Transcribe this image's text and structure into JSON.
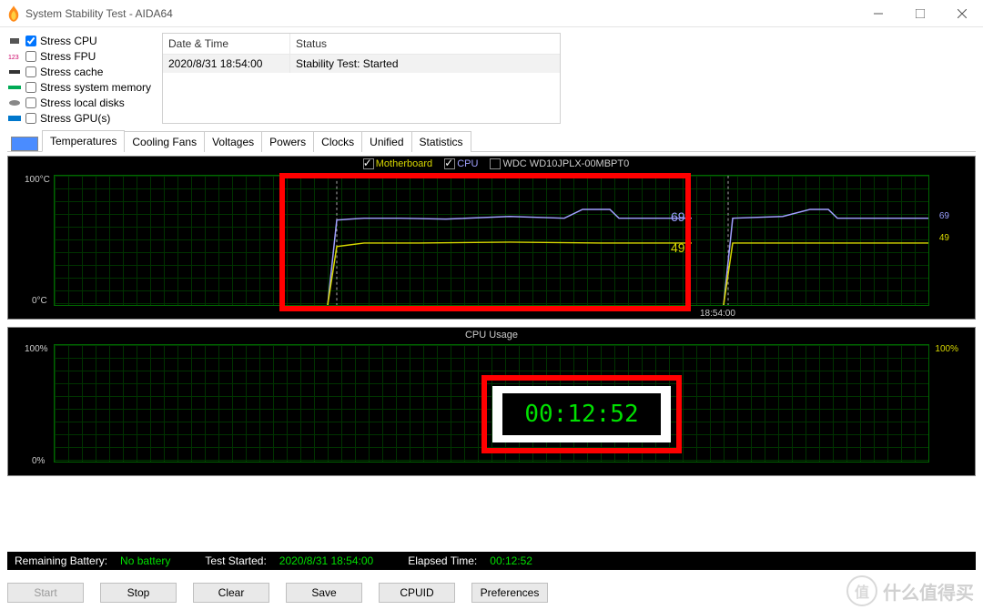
{
  "window": {
    "title": "System Stability Test - AIDA64"
  },
  "stress": {
    "cpu": {
      "label": "Stress CPU",
      "checked": true
    },
    "fpu": {
      "label": "Stress FPU",
      "checked": false
    },
    "cache": {
      "label": "Stress cache",
      "checked": false
    },
    "mem": {
      "label": "Stress system memory",
      "checked": false
    },
    "disk": {
      "label": "Stress local disks",
      "checked": false
    },
    "gpu": {
      "label": "Stress GPU(s)",
      "checked": false
    }
  },
  "log": {
    "headers": {
      "datetime": "Date & Time",
      "status": "Status"
    },
    "row0": {
      "datetime": "2020/8/31 18:54:00",
      "status": "Stability Test: Started"
    }
  },
  "tabs": [
    "Temperatures",
    "Cooling Fans",
    "Voltages",
    "Powers",
    "Clocks",
    "Unified",
    "Statistics"
  ],
  "temp_chart": {
    "title_legend": {
      "mb": "Motherboard",
      "cpu": "CPU",
      "wd": "WDC WD10JPLX-00MBPT0"
    },
    "y_max_label": "100°C",
    "y_min_label": "0°C",
    "x_tick": "18:54:00",
    "value_cpu": "69",
    "value_mb": "49",
    "right_value_cpu": "69",
    "right_value_mb": "49"
  },
  "cpu_chart": {
    "title": "CPU Usage",
    "y_max_left": "100%",
    "y_max_right": "100%",
    "y_min_left": "0%"
  },
  "overlay_timer": "00:12:52",
  "status": {
    "battery_label": "Remaining Battery:",
    "battery_value": "No battery",
    "started_label": "Test Started:",
    "started_value": "2020/8/31 18:54:00",
    "elapsed_label": "Elapsed Time:",
    "elapsed_value": "00:12:52"
  },
  "buttons": {
    "start": "Start",
    "stop": "Stop",
    "clear": "Clear",
    "save": "Save",
    "cpuid": "CPUID",
    "prefs": "Preferences"
  },
  "watermark": {
    "circle": "值",
    "text": "什么值得买"
  },
  "chart_data": {
    "type": "line",
    "charts": [
      {
        "name": "Temperatures",
        "ylabel": "°C",
        "ylim": [
          0,
          100
        ],
        "series": [
          {
            "name": "CPU",
            "color": "#9aa0ff",
            "current": 69,
            "values": [
              0,
              0,
              0,
              0,
              0,
              67,
              66,
              69,
              69,
              68,
              69,
              69,
              70,
              73,
              73,
              69,
              69,
              69,
              69
            ]
          },
          {
            "name": "Motherboard",
            "color": "#d8d800",
            "current": 49,
            "values": [
              0,
              0,
              0,
              0,
              0,
              46,
              49,
              49,
              49,
              48,
              49,
              49,
              49,
              49,
              49,
              49,
              49,
              49,
              49
            ]
          },
          {
            "name": "WDC WD10JPLX-00MBPT0",
            "color": "#ffffff",
            "current": null,
            "values": []
          }
        ],
        "x_start_label": "18:54:00"
      },
      {
        "name": "CPU Usage",
        "ylabel": "%",
        "ylim": [
          0,
          100
        ],
        "series": [
          {
            "name": "CPU Usage",
            "color": "#00c000",
            "current": 100,
            "values": [
              0,
              0,
              0,
              0,
              0,
              100,
              100,
              100,
              100,
              100,
              100,
              100,
              100,
              100,
              100,
              100,
              100,
              100,
              100
            ]
          }
        ]
      }
    ]
  }
}
